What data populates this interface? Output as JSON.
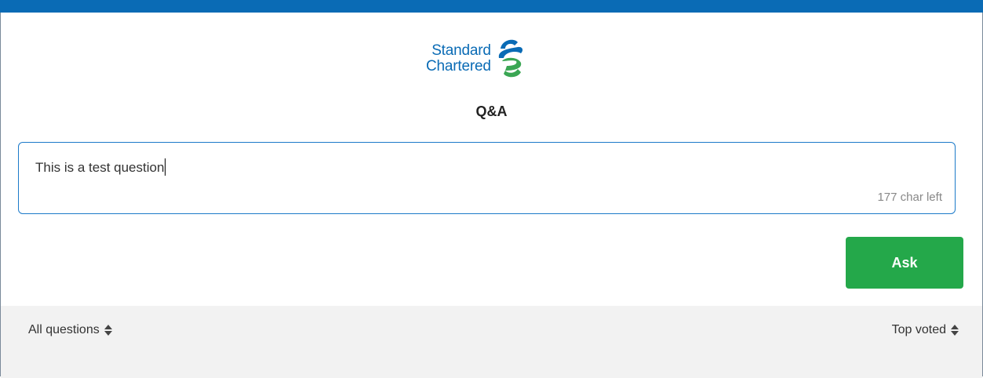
{
  "brand": {
    "line1": "Standard",
    "line2": "Chartered",
    "color": "#0a6bb5"
  },
  "page": {
    "title": "Q&A"
  },
  "question": {
    "value": "This is a test question",
    "chars_left": "177 char left",
    "focused_border_color": "#1c7ac9"
  },
  "actions": {
    "ask_label": "Ask",
    "ask_color": "#24a84a"
  },
  "filters": {
    "left_label": "All questions",
    "right_label": "Top voted",
    "sort_icon": "sort-icon"
  }
}
